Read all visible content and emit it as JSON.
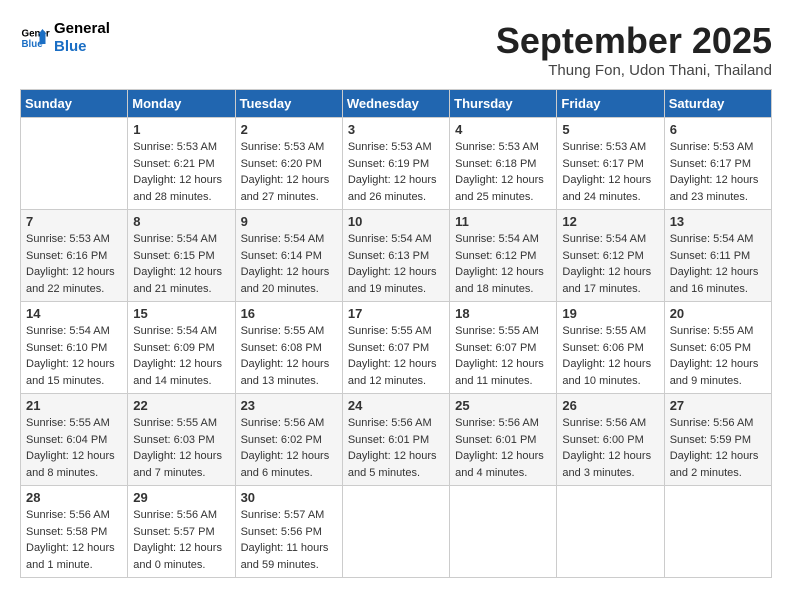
{
  "header": {
    "logo_line1": "General",
    "logo_line2": "Blue",
    "month": "September 2025",
    "location": "Thung Fon, Udon Thani, Thailand"
  },
  "weekdays": [
    "Sunday",
    "Monday",
    "Tuesday",
    "Wednesday",
    "Thursday",
    "Friday",
    "Saturday"
  ],
  "weeks": [
    [
      {
        "day": "",
        "info": ""
      },
      {
        "day": "1",
        "info": "Sunrise: 5:53 AM\nSunset: 6:21 PM\nDaylight: 12 hours\nand 28 minutes."
      },
      {
        "day": "2",
        "info": "Sunrise: 5:53 AM\nSunset: 6:20 PM\nDaylight: 12 hours\nand 27 minutes."
      },
      {
        "day": "3",
        "info": "Sunrise: 5:53 AM\nSunset: 6:19 PM\nDaylight: 12 hours\nand 26 minutes."
      },
      {
        "day": "4",
        "info": "Sunrise: 5:53 AM\nSunset: 6:18 PM\nDaylight: 12 hours\nand 25 minutes."
      },
      {
        "day": "5",
        "info": "Sunrise: 5:53 AM\nSunset: 6:17 PM\nDaylight: 12 hours\nand 24 minutes."
      },
      {
        "day": "6",
        "info": "Sunrise: 5:53 AM\nSunset: 6:17 PM\nDaylight: 12 hours\nand 23 minutes."
      }
    ],
    [
      {
        "day": "7",
        "info": "Sunrise: 5:53 AM\nSunset: 6:16 PM\nDaylight: 12 hours\nand 22 minutes."
      },
      {
        "day": "8",
        "info": "Sunrise: 5:54 AM\nSunset: 6:15 PM\nDaylight: 12 hours\nand 21 minutes."
      },
      {
        "day": "9",
        "info": "Sunrise: 5:54 AM\nSunset: 6:14 PM\nDaylight: 12 hours\nand 20 minutes."
      },
      {
        "day": "10",
        "info": "Sunrise: 5:54 AM\nSunset: 6:13 PM\nDaylight: 12 hours\nand 19 minutes."
      },
      {
        "day": "11",
        "info": "Sunrise: 5:54 AM\nSunset: 6:12 PM\nDaylight: 12 hours\nand 18 minutes."
      },
      {
        "day": "12",
        "info": "Sunrise: 5:54 AM\nSunset: 6:12 PM\nDaylight: 12 hours\nand 17 minutes."
      },
      {
        "day": "13",
        "info": "Sunrise: 5:54 AM\nSunset: 6:11 PM\nDaylight: 12 hours\nand 16 minutes."
      }
    ],
    [
      {
        "day": "14",
        "info": "Sunrise: 5:54 AM\nSunset: 6:10 PM\nDaylight: 12 hours\nand 15 minutes."
      },
      {
        "day": "15",
        "info": "Sunrise: 5:54 AM\nSunset: 6:09 PM\nDaylight: 12 hours\nand 14 minutes."
      },
      {
        "day": "16",
        "info": "Sunrise: 5:55 AM\nSunset: 6:08 PM\nDaylight: 12 hours\nand 13 minutes."
      },
      {
        "day": "17",
        "info": "Sunrise: 5:55 AM\nSunset: 6:07 PM\nDaylight: 12 hours\nand 12 minutes."
      },
      {
        "day": "18",
        "info": "Sunrise: 5:55 AM\nSunset: 6:07 PM\nDaylight: 12 hours\nand 11 minutes."
      },
      {
        "day": "19",
        "info": "Sunrise: 5:55 AM\nSunset: 6:06 PM\nDaylight: 12 hours\nand 10 minutes."
      },
      {
        "day": "20",
        "info": "Sunrise: 5:55 AM\nSunset: 6:05 PM\nDaylight: 12 hours\nand 9 minutes."
      }
    ],
    [
      {
        "day": "21",
        "info": "Sunrise: 5:55 AM\nSunset: 6:04 PM\nDaylight: 12 hours\nand 8 minutes."
      },
      {
        "day": "22",
        "info": "Sunrise: 5:55 AM\nSunset: 6:03 PM\nDaylight: 12 hours\nand 7 minutes."
      },
      {
        "day": "23",
        "info": "Sunrise: 5:56 AM\nSunset: 6:02 PM\nDaylight: 12 hours\nand 6 minutes."
      },
      {
        "day": "24",
        "info": "Sunrise: 5:56 AM\nSunset: 6:01 PM\nDaylight: 12 hours\nand 5 minutes."
      },
      {
        "day": "25",
        "info": "Sunrise: 5:56 AM\nSunset: 6:01 PM\nDaylight: 12 hours\nand 4 minutes."
      },
      {
        "day": "26",
        "info": "Sunrise: 5:56 AM\nSunset: 6:00 PM\nDaylight: 12 hours\nand 3 minutes."
      },
      {
        "day": "27",
        "info": "Sunrise: 5:56 AM\nSunset: 5:59 PM\nDaylight: 12 hours\nand 2 minutes."
      }
    ],
    [
      {
        "day": "28",
        "info": "Sunrise: 5:56 AM\nSunset: 5:58 PM\nDaylight: 12 hours\nand 1 minute."
      },
      {
        "day": "29",
        "info": "Sunrise: 5:56 AM\nSunset: 5:57 PM\nDaylight: 12 hours\nand 0 minutes."
      },
      {
        "day": "30",
        "info": "Sunrise: 5:57 AM\nSunset: 5:56 PM\nDaylight: 11 hours\nand 59 minutes."
      },
      {
        "day": "",
        "info": ""
      },
      {
        "day": "",
        "info": ""
      },
      {
        "day": "",
        "info": ""
      },
      {
        "day": "",
        "info": ""
      }
    ]
  ]
}
